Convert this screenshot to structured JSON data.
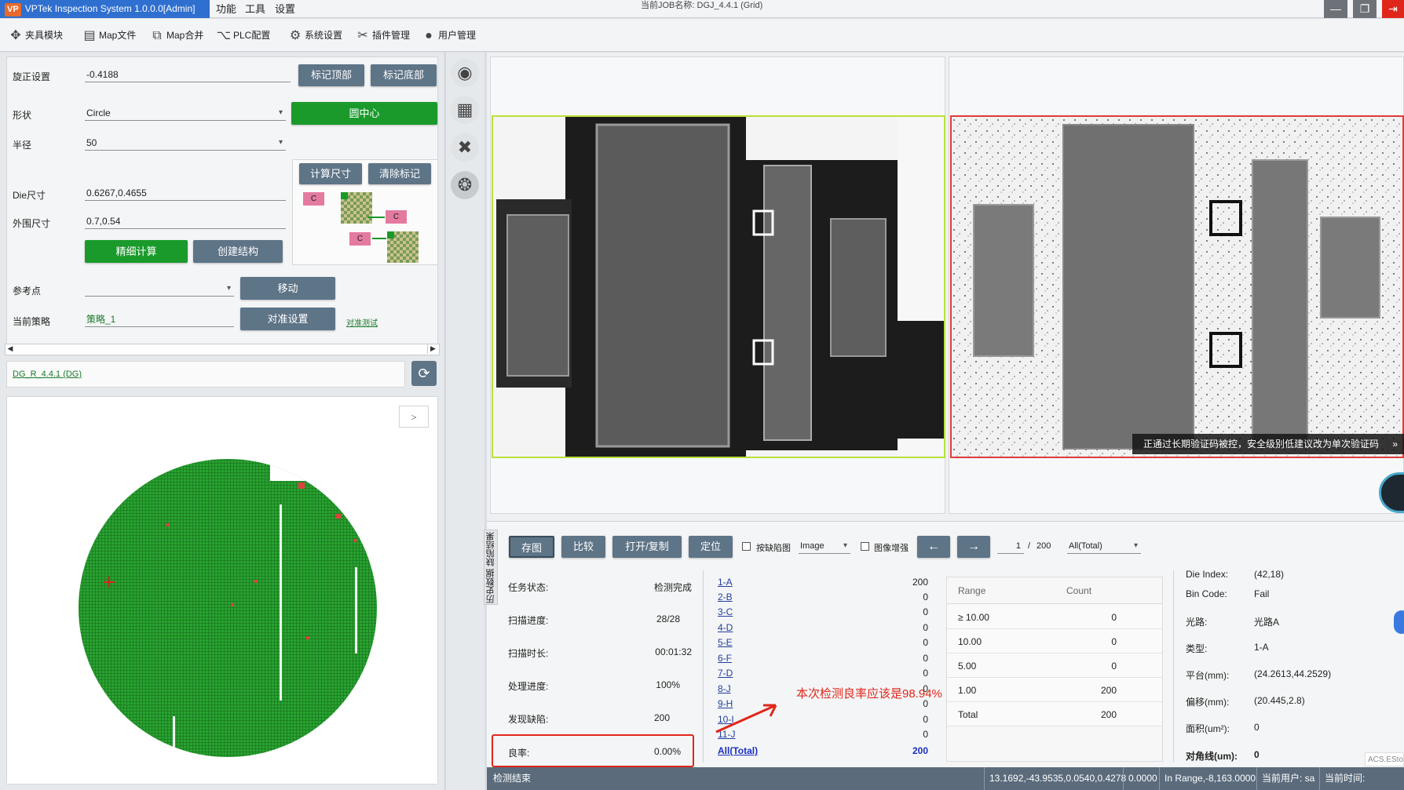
{
  "titlebar": {
    "app_title": "VPTek Inspection System 1.0.0.0[Admin]",
    "logo": "VP",
    "menu": [
      "功能",
      "工具",
      "设置"
    ],
    "job_name": "当前JOB名称: DGJ_4.4.1 (Grid)"
  },
  "toolbar": {
    "items": [
      {
        "label": "夹具模块",
        "icon": "fixture-icon"
      },
      {
        "label": "Map文件",
        "icon": "map-file-icon"
      },
      {
        "label": "Map合并",
        "icon": "map-merge-icon"
      },
      {
        "label": "PLC配置",
        "icon": "plc-icon"
      },
      {
        "label": "系统设置",
        "icon": "gear-icon"
      },
      {
        "label": "插件管理",
        "icon": "plugin-tools-icon"
      },
      {
        "label": "用户管理",
        "icon": "user-icon"
      }
    ]
  },
  "form": {
    "rotation_label": "旋正设置",
    "rotation_value": "-0.4188",
    "mark_top": "标记顶部",
    "mark_bottom": "标记底部",
    "shape_label": "形状",
    "shape_value": "Circle",
    "center_button": "圆中心",
    "radius_label": "半径",
    "radius_value": "50",
    "calc_size": "计算尺寸",
    "clear_mark": "清除标记",
    "die_size_label": "Die尺寸",
    "die_size_value": "0.6267,0.4655",
    "outer_size_label": "外围尺寸",
    "outer_size_value": "0.7,0.54",
    "fine_calc": "精细计算",
    "create_struct": "创建结构",
    "ref_point_label": "参考点",
    "ref_point_value": "",
    "move_button": "移动",
    "strategy_label": "当前策略",
    "strategy_value": "策略_1",
    "align_settings": "对准设置",
    "align_test": "对准测试",
    "diagram_c": "C"
  },
  "job_link": "DG_R_4.4.1 (DG)",
  "wafer_panel": {
    "expand": ">"
  },
  "image_panel": {
    "warning": "正通过长期验证码被控，安全级别低建议改为单次验证码",
    "warning_more": "»"
  },
  "result_toolbar": {
    "save_image": "存图",
    "compare": "比较",
    "open_copy": "打开/复制",
    "locate": "定位",
    "by_defect_label": "按缺陷图",
    "image_select": "Image",
    "enhance_label": "图像增强",
    "prev": "←",
    "next": "→",
    "page_current": "1",
    "page_sep": "/",
    "page_total": "200",
    "filter_select": "All(Total)",
    "history_tab": "历史数据  缺陷结果"
  },
  "stats": [
    {
      "label": "任务状态:",
      "value": "检测完成"
    },
    {
      "label": "扫描进度:",
      "value": "28/28"
    },
    {
      "label": "扫描时长:",
      "value": "00:01:32"
    },
    {
      "label": "处理进度:",
      "value": "100%"
    },
    {
      "label": "发现缺陷:",
      "value": "200"
    },
    {
      "label": "良率:",
      "value": "0.00%"
    }
  ],
  "bins": [
    {
      "name": "1-A",
      "count": "200"
    },
    {
      "name": "2-B",
      "count": "0"
    },
    {
      "name": "3-C",
      "count": "0"
    },
    {
      "name": "4-D",
      "count": "0"
    },
    {
      "name": "5-E",
      "count": "0"
    },
    {
      "name": "6-F",
      "count": "0"
    },
    {
      "name": "7-D",
      "count": "0"
    },
    {
      "name": "8-J",
      "count": "0"
    },
    {
      "name": "9-H",
      "count": "0"
    },
    {
      "name": "10-I",
      "count": "0"
    },
    {
      "name": "11-J",
      "count": "0"
    },
    {
      "name": "All(Total)",
      "count": "200"
    }
  ],
  "range_table": {
    "headers": [
      "Range",
      "Count"
    ],
    "rows": [
      {
        "range": "≥ 10.00",
        "count": "0"
      },
      {
        "range": "10.00",
        "count": "0"
      },
      {
        "range": "5.00",
        "count": "0"
      },
      {
        "range": "1.00",
        "count": "200"
      },
      {
        "range": "Total",
        "count": "200"
      }
    ]
  },
  "details": [
    {
      "label": "Die Index:",
      "value": "(42,18)"
    },
    {
      "label": "Bin Code:",
      "value": "Fail"
    },
    {
      "label": "光路:",
      "value": "光路A"
    },
    {
      "label": "类型:",
      "value": "1-A"
    },
    {
      "label": "平台(mm):",
      "value": "(24.2613,44.2529)"
    },
    {
      "label": "偏移(mm):",
      "value": "(20.445,2.8)"
    },
    {
      "label": "面积(um²):",
      "value": "0"
    },
    {
      "label": "对角线(um):",
      "value": "0"
    }
  ],
  "annotation": "本次检测良率应该是98.94%",
  "status_bar": {
    "left": "检测结束",
    "coords": "13.1692,-43.9535,0.0540,0.4278",
    "value2": "0.0000",
    "range": "In Range,-8,163.0000",
    "user": "当前用户: sa",
    "time": "当前时间:"
  },
  "watermark": "ACS.EStor",
  "colors": {
    "accent": "#2f6fd0",
    "green": "#1a9a2b",
    "button": "#5e7487",
    "alert": "#e0261b"
  }
}
